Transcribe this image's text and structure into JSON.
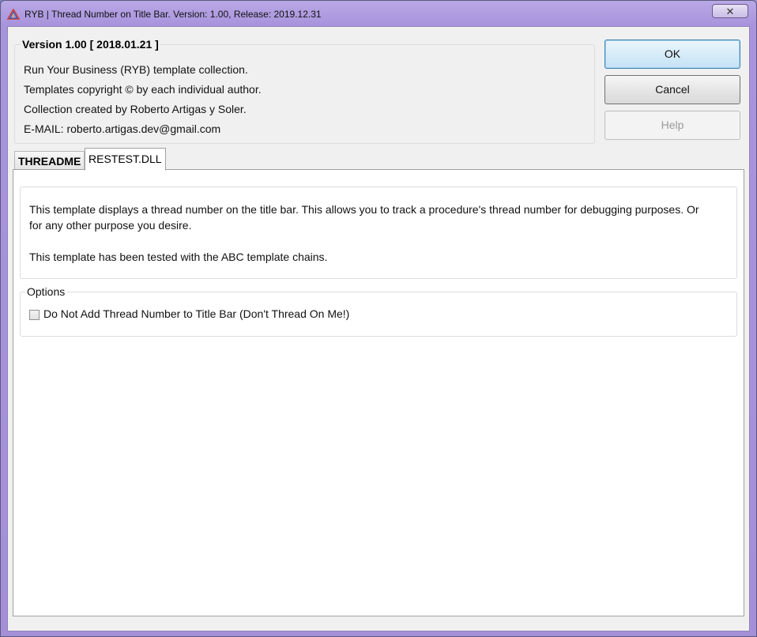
{
  "window": {
    "title": "RYB | Thread Number on Title Bar. Version: 1.00, Release: 2019.12.31",
    "close_symbol": "✕"
  },
  "about": {
    "version": "Version 1.00 [ 2018.01.21 ]",
    "lines": [
      "Run Your Business (RYB) template collection.",
      "Templates copyright © by each individual author.",
      "Collection created by Roberto Artigas y Soler.",
      "E-MAIL: roberto.artigas.dev@gmail.com"
    ]
  },
  "buttons": {
    "ok": "OK",
    "cancel": "Cancel",
    "help": "Help"
  },
  "tabs": [
    {
      "label": "THREADME",
      "active": false
    },
    {
      "label": "RESTEST.DLL",
      "active": true
    }
  ],
  "panel": {
    "description": [
      "This template displays a thread number on the title bar. This allows you to track a procedure's thread number for debugging purposes. Or for any other purpose you desire.",
      "This template has been tested with the ABC template chains."
    ],
    "options_title": "Options",
    "checkbox_label": "Do Not Add Thread Number to Title Bar (Don't Thread On Me!)",
    "checkbox_checked": false
  },
  "icons": {
    "app": "ryb-triangle-icon",
    "close": "close-icon"
  }
}
